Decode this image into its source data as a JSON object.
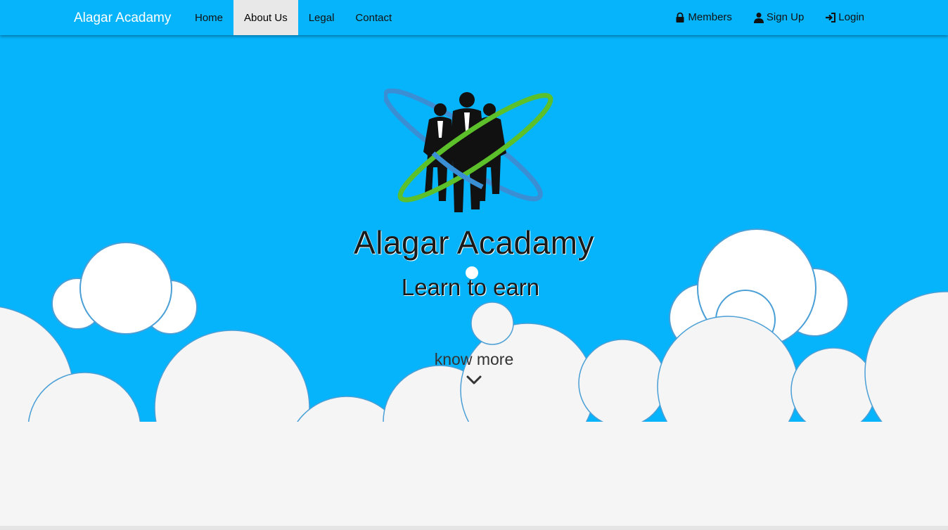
{
  "navbar": {
    "brand": "Alagar Acadamy",
    "left_items": [
      {
        "label": "Home",
        "active": false
      },
      {
        "label": "About Us",
        "active": true
      },
      {
        "label": "Legal",
        "active": false
      },
      {
        "label": "Contact",
        "active": false
      }
    ],
    "right_items": [
      {
        "label": "Members",
        "icon": "lock-icon"
      },
      {
        "label": "Sign Up",
        "icon": "user-icon"
      },
      {
        "label": "Login",
        "icon": "login-icon"
      }
    ]
  },
  "hero": {
    "logo_title": "Alagar Acadamy",
    "logo_tagline": "Learn to earn",
    "know_more": "know more",
    "know_more_icon": "chevron-down-icon"
  },
  "colors": {
    "sky": "#06b4fc",
    "cloud": "#f5f5f5",
    "cloud_outline": "#4a9fd6",
    "active_tab": "#e8e8e8",
    "logo_blue_ring": "#3a8fd4",
    "logo_green_ring": "#5cc02a"
  }
}
